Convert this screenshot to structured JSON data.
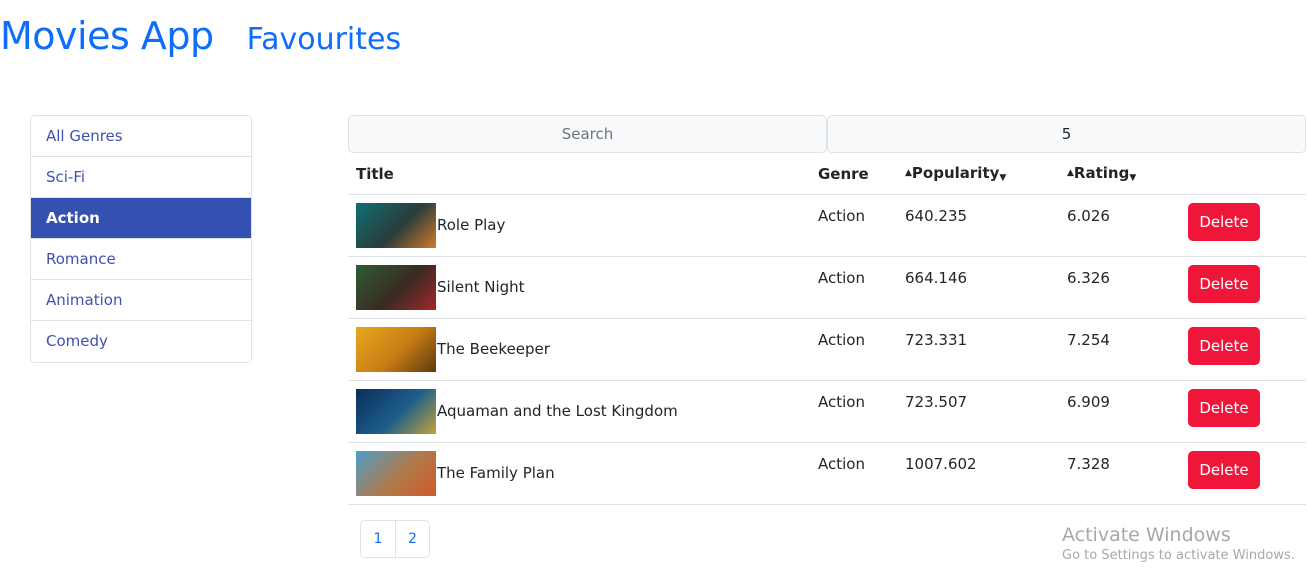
{
  "header": {
    "brand": "Movies App",
    "nav_favourites": "Favourites"
  },
  "genres": [
    "All Genres",
    "Sci-Fi",
    "Action",
    "Romance",
    "Animation",
    "Comedy"
  ],
  "active_genre": "Action",
  "search": {
    "placeholder": "Search",
    "count_value": "5"
  },
  "table": {
    "headers": {
      "title": "Title",
      "genre": "Genre",
      "popularity": "Popularity",
      "rating": "Rating"
    },
    "sort_up_icon": "caret-up-icon",
    "sort_down_icon": "caret-down-icon",
    "rows": [
      {
        "title": "Role Play",
        "genre": "Action",
        "popularity": "640.235",
        "rating": "6.026",
        "action": "Delete",
        "poster_colors": [
          "#0f6f74",
          "#2b3c3a",
          "#d07a2e"
        ]
      },
      {
        "title": "Silent Night",
        "genre": "Action",
        "popularity": "664.146",
        "rating": "6.326",
        "action": "Delete",
        "poster_colors": [
          "#2f5b33",
          "#3a2a22",
          "#a22a2a"
        ]
      },
      {
        "title": "The Beekeeper",
        "genre": "Action",
        "popularity": "723.331",
        "rating": "7.254",
        "action": "Delete",
        "poster_colors": [
          "#e8a81e",
          "#c77b14",
          "#5a3a10"
        ]
      },
      {
        "title": "Aquaman and the Lost Kingdom",
        "genre": "Action",
        "popularity": "723.507",
        "rating": "6.909",
        "action": "Delete",
        "poster_colors": [
          "#0b2c5a",
          "#1e5f8c",
          "#c4a23a"
        ]
      },
      {
        "title": "The Family Plan",
        "genre": "Action",
        "popularity": "1007.602",
        "rating": "7.328",
        "action": "Delete",
        "poster_colors": [
          "#4d9ec9",
          "#b07a4a",
          "#d05a2a"
        ]
      }
    ]
  },
  "pagination": [
    "1",
    "2"
  ],
  "watermark": {
    "title": "Activate Windows",
    "subtitle": "Go to Settings to activate Windows."
  },
  "colors": {
    "primary": "#0d6efd",
    "active_genre_bg": "#3451b2",
    "delete_btn": "#f0163a"
  }
}
